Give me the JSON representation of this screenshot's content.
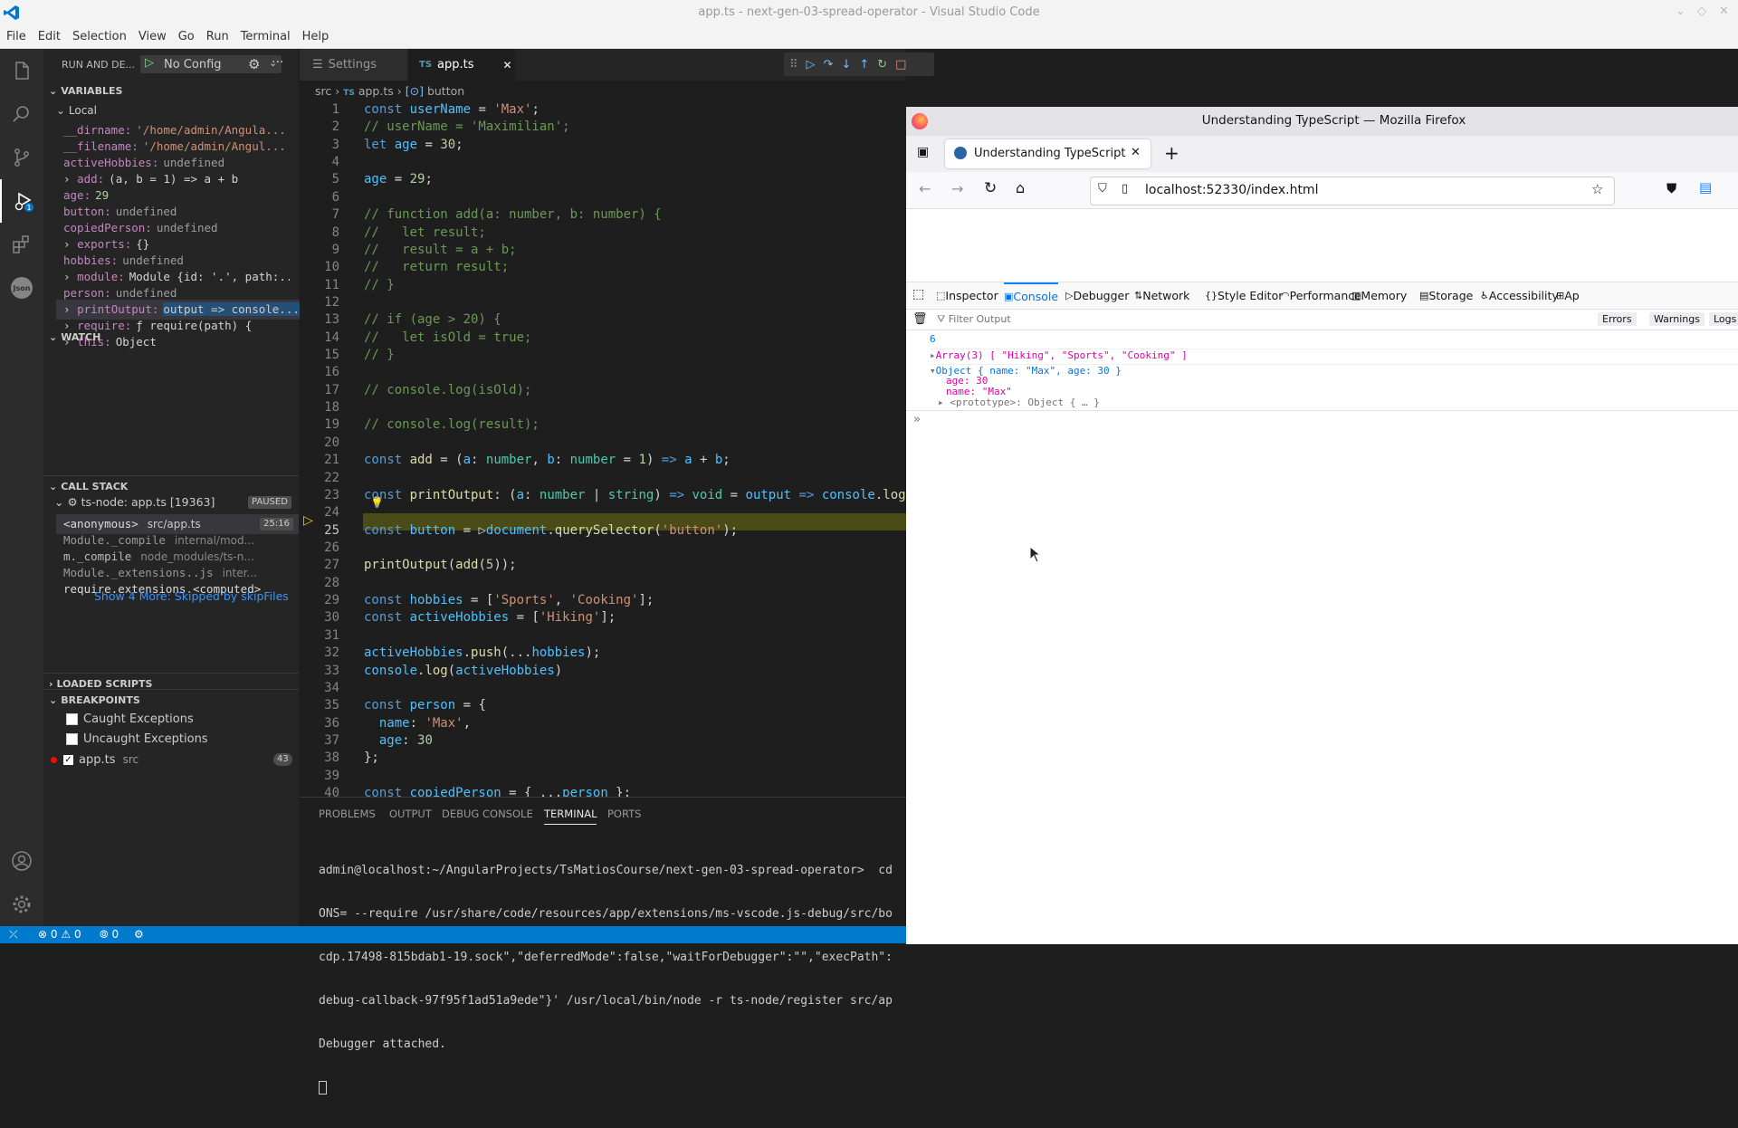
{
  "window": {
    "title": "app.ts - next-gen-03-spread-operator - Visual Studio Code"
  },
  "menu": [
    "File",
    "Edit",
    "Selection",
    "View",
    "Go",
    "Run",
    "Terminal",
    "Help"
  ],
  "sidebar": {
    "run_label": "RUN AND DE...",
    "config": "No Config",
    "variables_header": "VARIABLES",
    "local_label": "Local",
    "variables": [
      {
        "name": "__dirname:",
        "value": "'/home/admin/Angula..."
      },
      {
        "name": "__filename:",
        "value": "'/home/admin/Angul..."
      },
      {
        "name": "activeHobbies:",
        "value": "undefined"
      },
      {
        "name": "add:",
        "value": "(a, b = 1) => a + b"
      },
      {
        "name": "age:",
        "value": "29"
      },
      {
        "name": "button:",
        "value": "undefined"
      },
      {
        "name": "copiedPerson:",
        "value": "undefined"
      },
      {
        "name": "exports:",
        "value": "{}"
      },
      {
        "name": "hobbies:",
        "value": "undefined"
      },
      {
        "name": "module:",
        "value": "Module {id: '.', path:..."
      },
      {
        "name": "person:",
        "value": "undefined"
      },
      {
        "name": "printOutput:",
        "value": "output => console..."
      },
      {
        "name": "require:",
        "value": "ƒ require(path) {"
      },
      {
        "name": "this:",
        "value": "Object"
      }
    ],
    "watch_header": "WATCH",
    "callstack_header": "CALL STACK",
    "thread": "ts-node: app.ts [19363]",
    "paused": "PAUSED",
    "frames": [
      {
        "name": "<anonymous>",
        "file": "src/app.ts",
        "pos": "25:16"
      },
      {
        "name": "Module._compile",
        "file": "internal/mod...",
        "pos": ""
      },
      {
        "name": "m._compile",
        "file": "node_modules/ts-n...",
        "pos": ""
      },
      {
        "name": "Module._extensions..js",
        "file": "inter...",
        "pos": ""
      },
      {
        "name": "require.extensions.<computed>",
        "file": "",
        "pos": ""
      }
    ],
    "show_more": "Show 4 More: Skipped by skipFiles",
    "loaded_scripts": "LOADED SCRIPTS",
    "breakpoints_header": "BREAKPOINTS",
    "breakpoints": [
      {
        "label": "Caught Exceptions",
        "sub": "",
        "count": ""
      },
      {
        "label": "Uncaught Exceptions",
        "sub": "",
        "count": ""
      },
      {
        "label": "app.ts",
        "sub": "src",
        "count": "43"
      }
    ]
  },
  "editor": {
    "tabs": [
      {
        "label": "Settings"
      },
      {
        "label": "app.ts",
        "prefix": "TS"
      }
    ],
    "breadcrumb": [
      "src",
      "app.ts",
      "button"
    ],
    "breadcrumb_ts": "TS",
    "current_line": 25
  },
  "panel": {
    "tabs": [
      "PROBLEMS",
      "OUTPUT",
      "DEBUG CONSOLE",
      "TERMINAL",
      "PORTS"
    ],
    "active_tab": "TERMINAL",
    "lines": [
      "admin@localhost:~/AngularProjects/TsMatiosCourse/next-gen-03-spread-operator>  cd",
      "ONS= --require /usr/share/code/resources/app/extensions/ms-vscode.js-debug/src/bo",
      "cdp.17498-815bdab1-19.sock\",\"deferredMode\":false,\"waitForDebugger\":\"\",\"execPath\":",
      "debug-callback-97f95f1ad51a9ede\"}' /usr/local/bin/node -r ts-node/register src/ap",
      "Debugger attached."
    ]
  },
  "status": {
    "errors": "0",
    "warnings": "0",
    "ports": "0"
  },
  "firefox": {
    "window_title": "Understanding TypeScript — Mozilla Firefox",
    "tab_title": "Understanding TypeScript",
    "url": "localhost:52330/index.html",
    "devtools_tabs": [
      "Inspector",
      "Console",
      "Debugger",
      "Network",
      "Style Editor",
      "Performance",
      "Memory",
      "Storage",
      "Accessibility",
      "Ap"
    ],
    "filter_placeholder": "Filter Output",
    "filters": [
      "Errors",
      "Warnings",
      "Logs"
    ],
    "console": {
      "line1": "6",
      "array_line": "Array(3) [ \"Hiking\", \"Sports\", \"Cooking\" ]",
      "object_line": "Object { name: \"Max\", age: 30 }",
      "age_line": "age: 30",
      "name_line": "name: \"Max\"",
      "proto_line": "<prototype>: Object { … }"
    }
  },
  "colors": {
    "accent": "#007acc",
    "highlight": "#4b4b18",
    "breakpoint": "#e51400"
  }
}
